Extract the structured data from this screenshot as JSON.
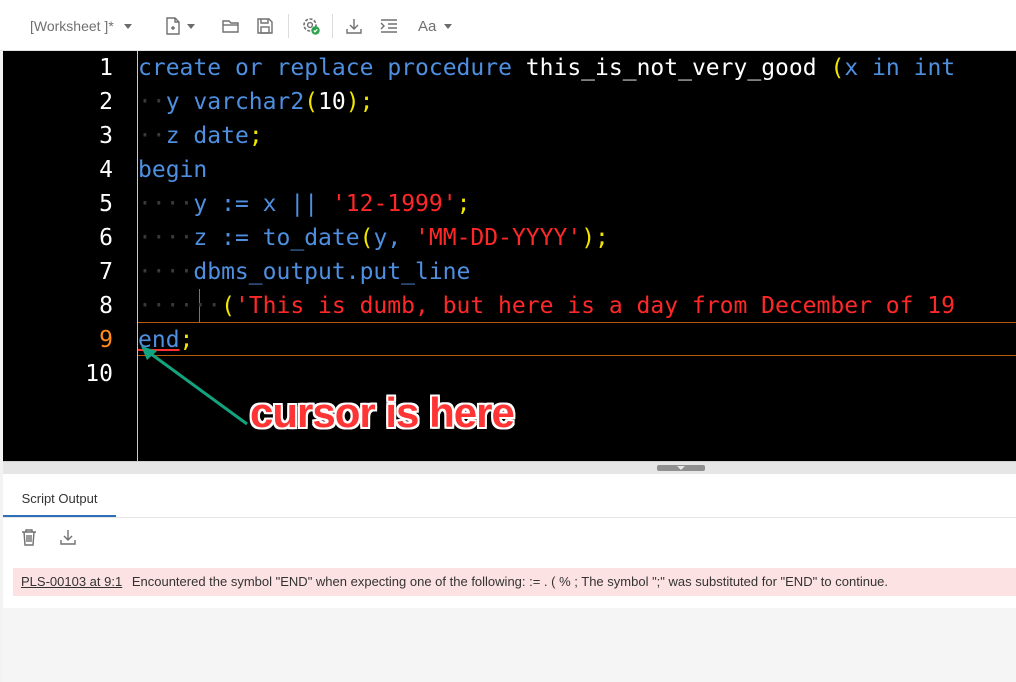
{
  "toolbar": {
    "worksheet_title": "[Worksheet ]*",
    "icons": [
      "new-file-icon",
      "open-folder-icon",
      "save-icon",
      "run-settings-icon",
      "download-icon",
      "format-indent-icon",
      "font-case-icon"
    ],
    "font_label": "Aa"
  },
  "editor": {
    "current_line": 9,
    "line_numbers": [
      "1",
      "2",
      "3",
      "4",
      "5",
      "6",
      "7",
      "8",
      "9",
      "10"
    ],
    "lines": {
      "l1": {
        "kw1": "create",
        "kw2": "or",
        "kw3": "replace",
        "kw4": "procedure",
        "name": "this_is_not_very_good",
        "paren": "(",
        "param": "x",
        "kw5": "in",
        "kw6": "int"
      },
      "l2": {
        "id": "y",
        "type": "varchar2",
        "open": "(",
        "num": "10",
        "close": ");"
      },
      "l3": {
        "id": "z",
        "type": "date",
        "semi": ";"
      },
      "l4": {
        "kw": "begin"
      },
      "l5": {
        "id": "y",
        "op": ":=",
        "id2": "x",
        "concat": "||",
        "str": "'12-1999'",
        "semi": ";"
      },
      "l6": {
        "id": "z",
        "op": ":=",
        "fn": "to_date",
        "open": "(",
        "arg": "y,",
        "str": "'MM-DD-YYYY'",
        "close": ");"
      },
      "l7": {
        "pkg": "dbms_output",
        "dot": ".",
        "fn": "put_line"
      },
      "l8": {
        "open": "(",
        "str": "'This is dumb, but here is a day from December of 19"
      },
      "l9": {
        "kw": "end",
        "semi": ";"
      }
    }
  },
  "annotation": {
    "text": "cursor is here"
  },
  "output": {
    "tab_label": "Script Output",
    "tool_icons": [
      "trash-icon",
      "download-icon"
    ],
    "error_code": "PLS-00103 at 9:1",
    "error_message": "Encountered the symbol \"END\" when expecting one of the following: := . ( % ; The symbol \";\" was substituted for \"END\" to continue."
  }
}
